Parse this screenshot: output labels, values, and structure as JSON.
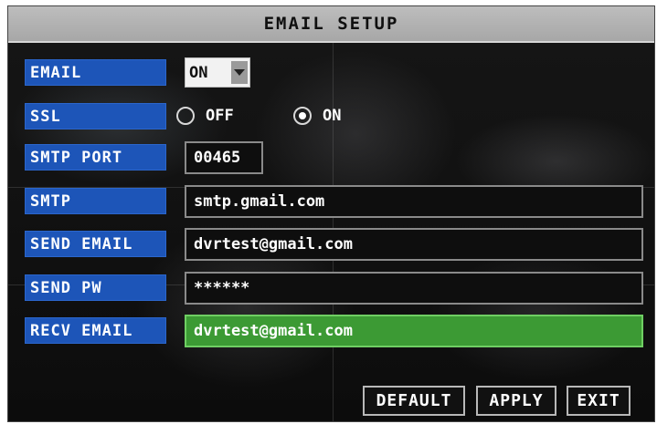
{
  "title": "EMAIL SETUP",
  "email": {
    "label": "EMAIL",
    "value": "ON"
  },
  "ssl": {
    "label": "SSL",
    "off_label": "OFF",
    "on_label": "ON",
    "selected": "ON"
  },
  "smtp_port": {
    "label": "SMTP PORT",
    "value": "00465"
  },
  "smtp": {
    "label": "SMTP",
    "value": "smtp.gmail.com"
  },
  "send_email": {
    "label": "SEND EMAIL",
    "value": "dvrtest@gmail.com"
  },
  "send_pw": {
    "label": "SEND PW",
    "value": "******"
  },
  "recv_email": {
    "label": "RECV EMAIL",
    "value": "dvrtest@gmail.com"
  },
  "buttons": {
    "default": "DEFAULT",
    "apply": "APPLY",
    "exit": "EXIT"
  },
  "colors": {
    "label_bg": "#1d55b8",
    "active_field": "#3c9a34",
    "title_bg": "#b3b3b3"
  }
}
